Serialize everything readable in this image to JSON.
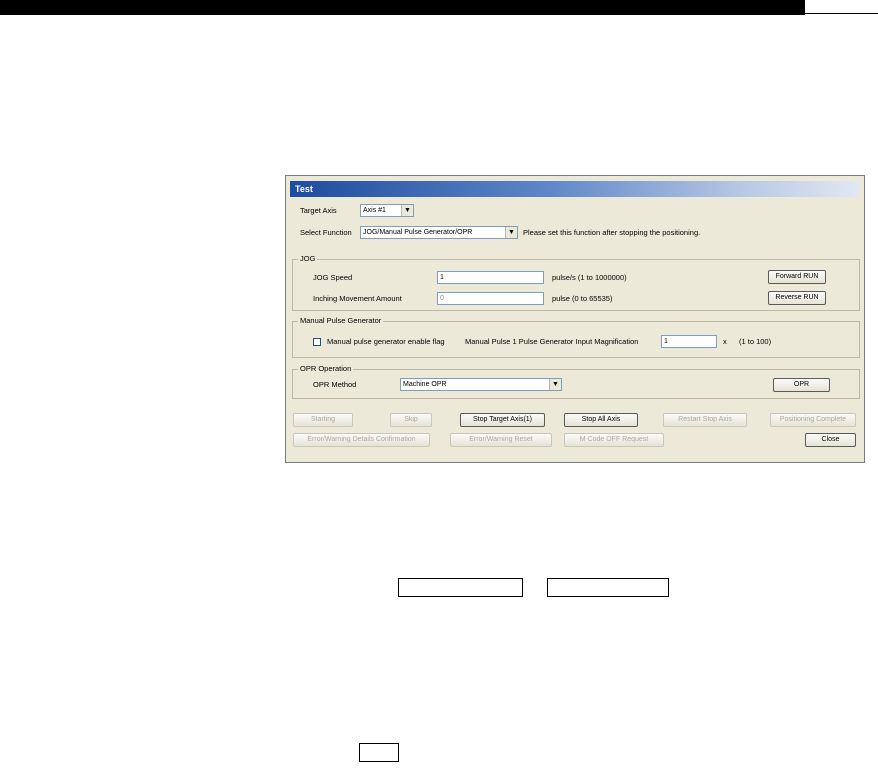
{
  "dialog": {
    "title": "Test",
    "target_axis": {
      "label": "Target Axis",
      "value": "Axis #1"
    },
    "select_function": {
      "label": "Select Function",
      "value": "JOG/Manual Pulse Generator/OPR",
      "note": "Please set this function after stopping the positioning."
    },
    "jog": {
      "title": "JOG",
      "speed_label": "JOG Speed",
      "speed_value": "1",
      "speed_unit": "pulse/s (1 to 1000000)",
      "inching_label": "Inching Movement Amount",
      "inching_value": "0",
      "inching_unit": "pulse (0 to 65535)",
      "forward_button": "Forward RUN",
      "reverse_button": "Reverse RUN"
    },
    "manual": {
      "title": "Manual Pulse Generator",
      "enable_label": "Manual pulse generator enable flag",
      "magnification_label": "Manual Pulse 1 Pulse Generator Input Magnification",
      "magnification_value": "1",
      "magnification_unit": "x",
      "magnification_range": "(1 to 100)"
    },
    "opr": {
      "title": "OPR Operation",
      "method_label": "OPR Method",
      "method_value": "Machine OPR",
      "opr_button": "OPR"
    },
    "buttons": {
      "starting": "Starting",
      "skip": "Skip",
      "stop_target_axis": "Stop Target Axis(1)",
      "stop_all_axis": "Stop All Axis",
      "restart_stop_axis": "Restart Stop Axis",
      "positioning_complete": "Positioning Complete",
      "error_warning_details": "Error/Warning Details Confirmation",
      "error_warning_reset": "Error/Warning Reset",
      "m_code_off": "M Code OFF Request",
      "close": "Close"
    }
  }
}
